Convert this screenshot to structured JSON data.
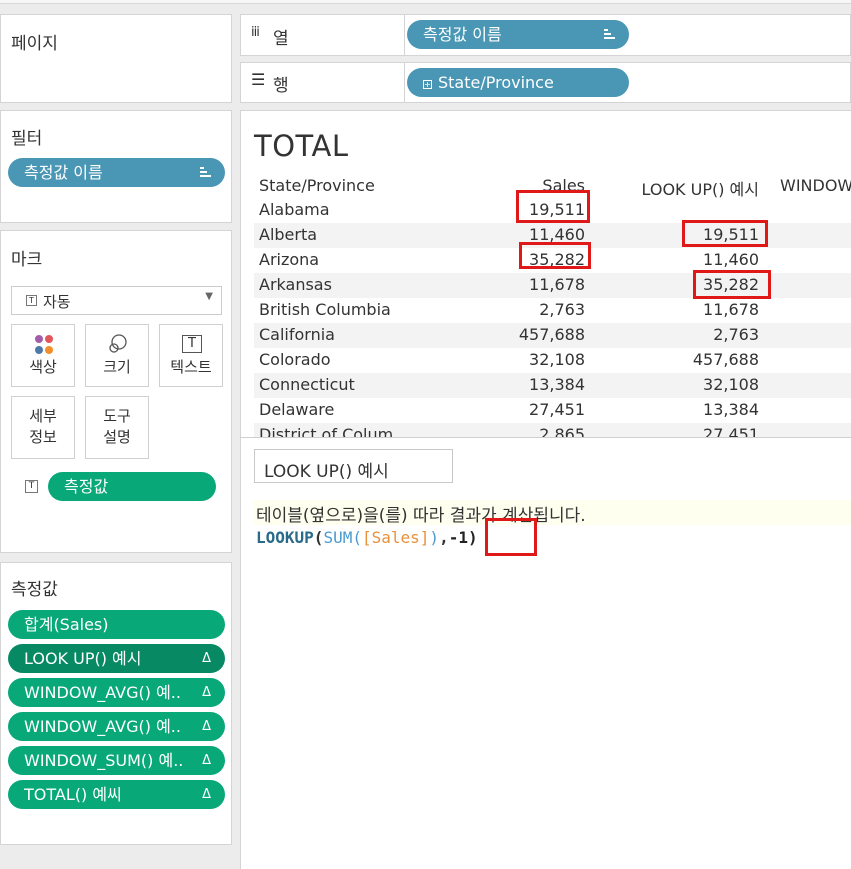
{
  "pages_card": {
    "title": "페이지"
  },
  "columns_shelf": {
    "label": "열",
    "pill": "측정값 이름"
  },
  "rows_shelf": {
    "label": "행",
    "pill": "State/Province"
  },
  "filters_card": {
    "title": "필터",
    "pill": "측정값 이름"
  },
  "marks_card": {
    "title": "마크",
    "mark_type": "자동",
    "buttons": {
      "color": "색상",
      "size": "크기",
      "text": "텍스트",
      "detail": "세부\n정보",
      "tooltip": "도구\n설명"
    },
    "pill": "측정값"
  },
  "measure_values_card": {
    "title": "측정값",
    "pills": [
      {
        "label": "합계(Sales)",
        "delta": ""
      },
      {
        "label": "LOOK UP() 예시",
        "delta": "Δ"
      },
      {
        "label": "WINDOW_AVG() 예..",
        "delta": "Δ"
      },
      {
        "label": "WINDOW_AVG() 예..",
        "delta": "Δ"
      },
      {
        "label": "WINDOW_SUM() 예..",
        "delta": "Δ"
      },
      {
        "label": "TOTAL() 예씨",
        "delta": "Δ"
      }
    ]
  },
  "view": {
    "title": "TOTAL",
    "headers": [
      "State/Province",
      "Sales",
      "LOOK UP() 예시",
      "WINDOW"
    ],
    "rows": [
      {
        "state": "Alabama",
        "sales": "19,511",
        "lookup": ""
      },
      {
        "state": "Alberta",
        "sales": "11,460",
        "lookup": "19,511"
      },
      {
        "state": "Arizona",
        "sales": "35,282",
        "lookup": "11,460"
      },
      {
        "state": "Arkansas",
        "sales": "11,678",
        "lookup": "35,282"
      },
      {
        "state": "British Columbia",
        "sales": "2,763",
        "lookup": "11,678"
      },
      {
        "state": "California",
        "sales": "457,688",
        "lookup": "2,763"
      },
      {
        "state": "Colorado",
        "sales": "32,108",
        "lookup": "457,688"
      },
      {
        "state": "Connecticut",
        "sales": "13,384",
        "lookup": "32,108"
      },
      {
        "state": "Delaware",
        "sales": "27,451",
        "lookup": "13,384"
      },
      {
        "state": "District of Colum",
        "sales": "2,865",
        "lookup": "27,451"
      }
    ]
  },
  "calc_panel": {
    "name": "LOOK UP() 예시",
    "note": "테이블(옆으로)을(를) 따라 결과가 계산됩니다.",
    "formula": {
      "fn": "LOOKUP",
      "open": "(",
      "agg": "SUM",
      "agg_open": "(",
      "field": "[Sales]",
      "agg_close": ")",
      "comma": ",",
      "arg": "-1",
      "close": ")"
    }
  },
  "colors": {
    "blue_pill": "#4a96b5",
    "green_pill": "#08a878",
    "highlight": "#e01818",
    "field": "#e8913a",
    "agg": "#4a9ad0",
    "fn": "#2a6a8a"
  }
}
